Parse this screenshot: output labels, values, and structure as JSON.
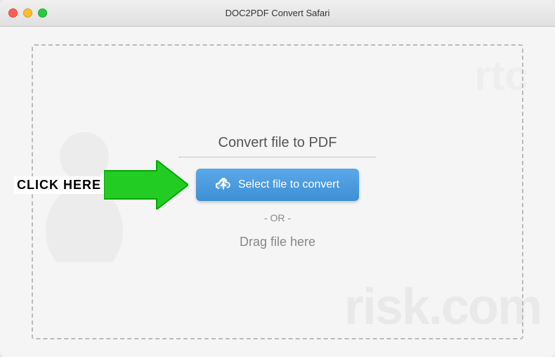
{
  "window": {
    "title": "DOC2PDF Convert Safari"
  },
  "titlebar": {
    "buttons": {
      "close_label": "",
      "minimize_label": "",
      "maximize_label": ""
    }
  },
  "main": {
    "heading": "Convert file to PDF",
    "select_button_label": "Select file to convert",
    "or_text": "- OR -",
    "drag_text": "Drag file here",
    "click_here_label": "CLICK HERE"
  },
  "watermark": {
    "text": "risk.com"
  }
}
